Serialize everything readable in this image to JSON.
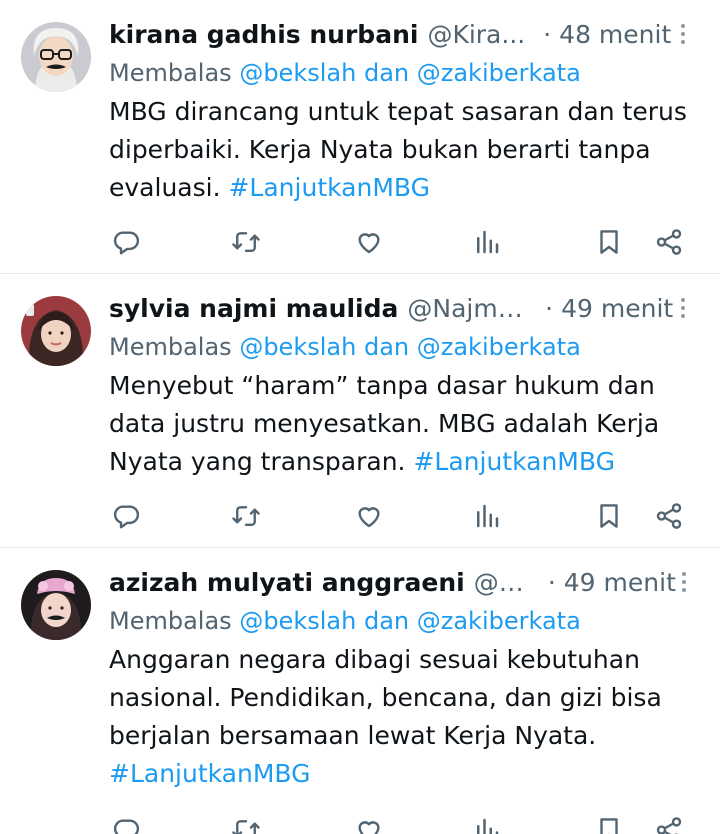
{
  "tweets": [
    {
      "name": "kirana gadhis nurbani",
      "handle": "@Kira...",
      "dot": "·",
      "time": "48 menit",
      "reply_prefix": "Membalas",
      "reply_mention1": "@bekslah",
      "reply_and": "dan",
      "reply_mention2": "@zakiberkata",
      "text": "MBG dirancang untuk tepat sasaran dan terus diperbaiki. Kerja Nyata bukan berarti tanpa evaluasi.",
      "hashtag": "#LanjutkanMBG"
    },
    {
      "name": "sylvia najmi maulida",
      "handle": "@Najmi...",
      "dot": "·",
      "time": "49 menit",
      "reply_prefix": "Membalas",
      "reply_mention1": "@bekslah",
      "reply_and": "dan",
      "reply_mention2": "@zakiberkata",
      "text": "Menyebut “haram” tanpa dasar hukum dan data justru menyesatkan. MBG adalah Kerja Nyata yang transparan.",
      "hashtag": "#LanjutkanMBG"
    },
    {
      "name": "azizah mulyati anggraeni",
      "handle": "@A...",
      "dot": "·",
      "time": "49 menit",
      "reply_prefix": "Membalas",
      "reply_mention1": "@bekslah",
      "reply_and": "dan",
      "reply_mention2": "@zakiberkata",
      "text": "Anggaran negara dibagi sesuai kebutuhan nasional. Pendidikan, bencana, dan gizi bisa berjalan bersamaan lewat Kerja Nyata.",
      "hashtag": "#LanjutkanMBG"
    }
  ],
  "icons": {
    "more": "more-options-icon",
    "reply": "reply-icon",
    "retweet": "retweet-icon",
    "like": "like-icon",
    "views": "views-icon",
    "bookmark": "bookmark-icon",
    "share": "share-icon"
  },
  "colors": {
    "link": "#1d9bf0",
    "secondary_text": "#536471",
    "icon": "#536471",
    "divider": "#e6ecf0"
  }
}
